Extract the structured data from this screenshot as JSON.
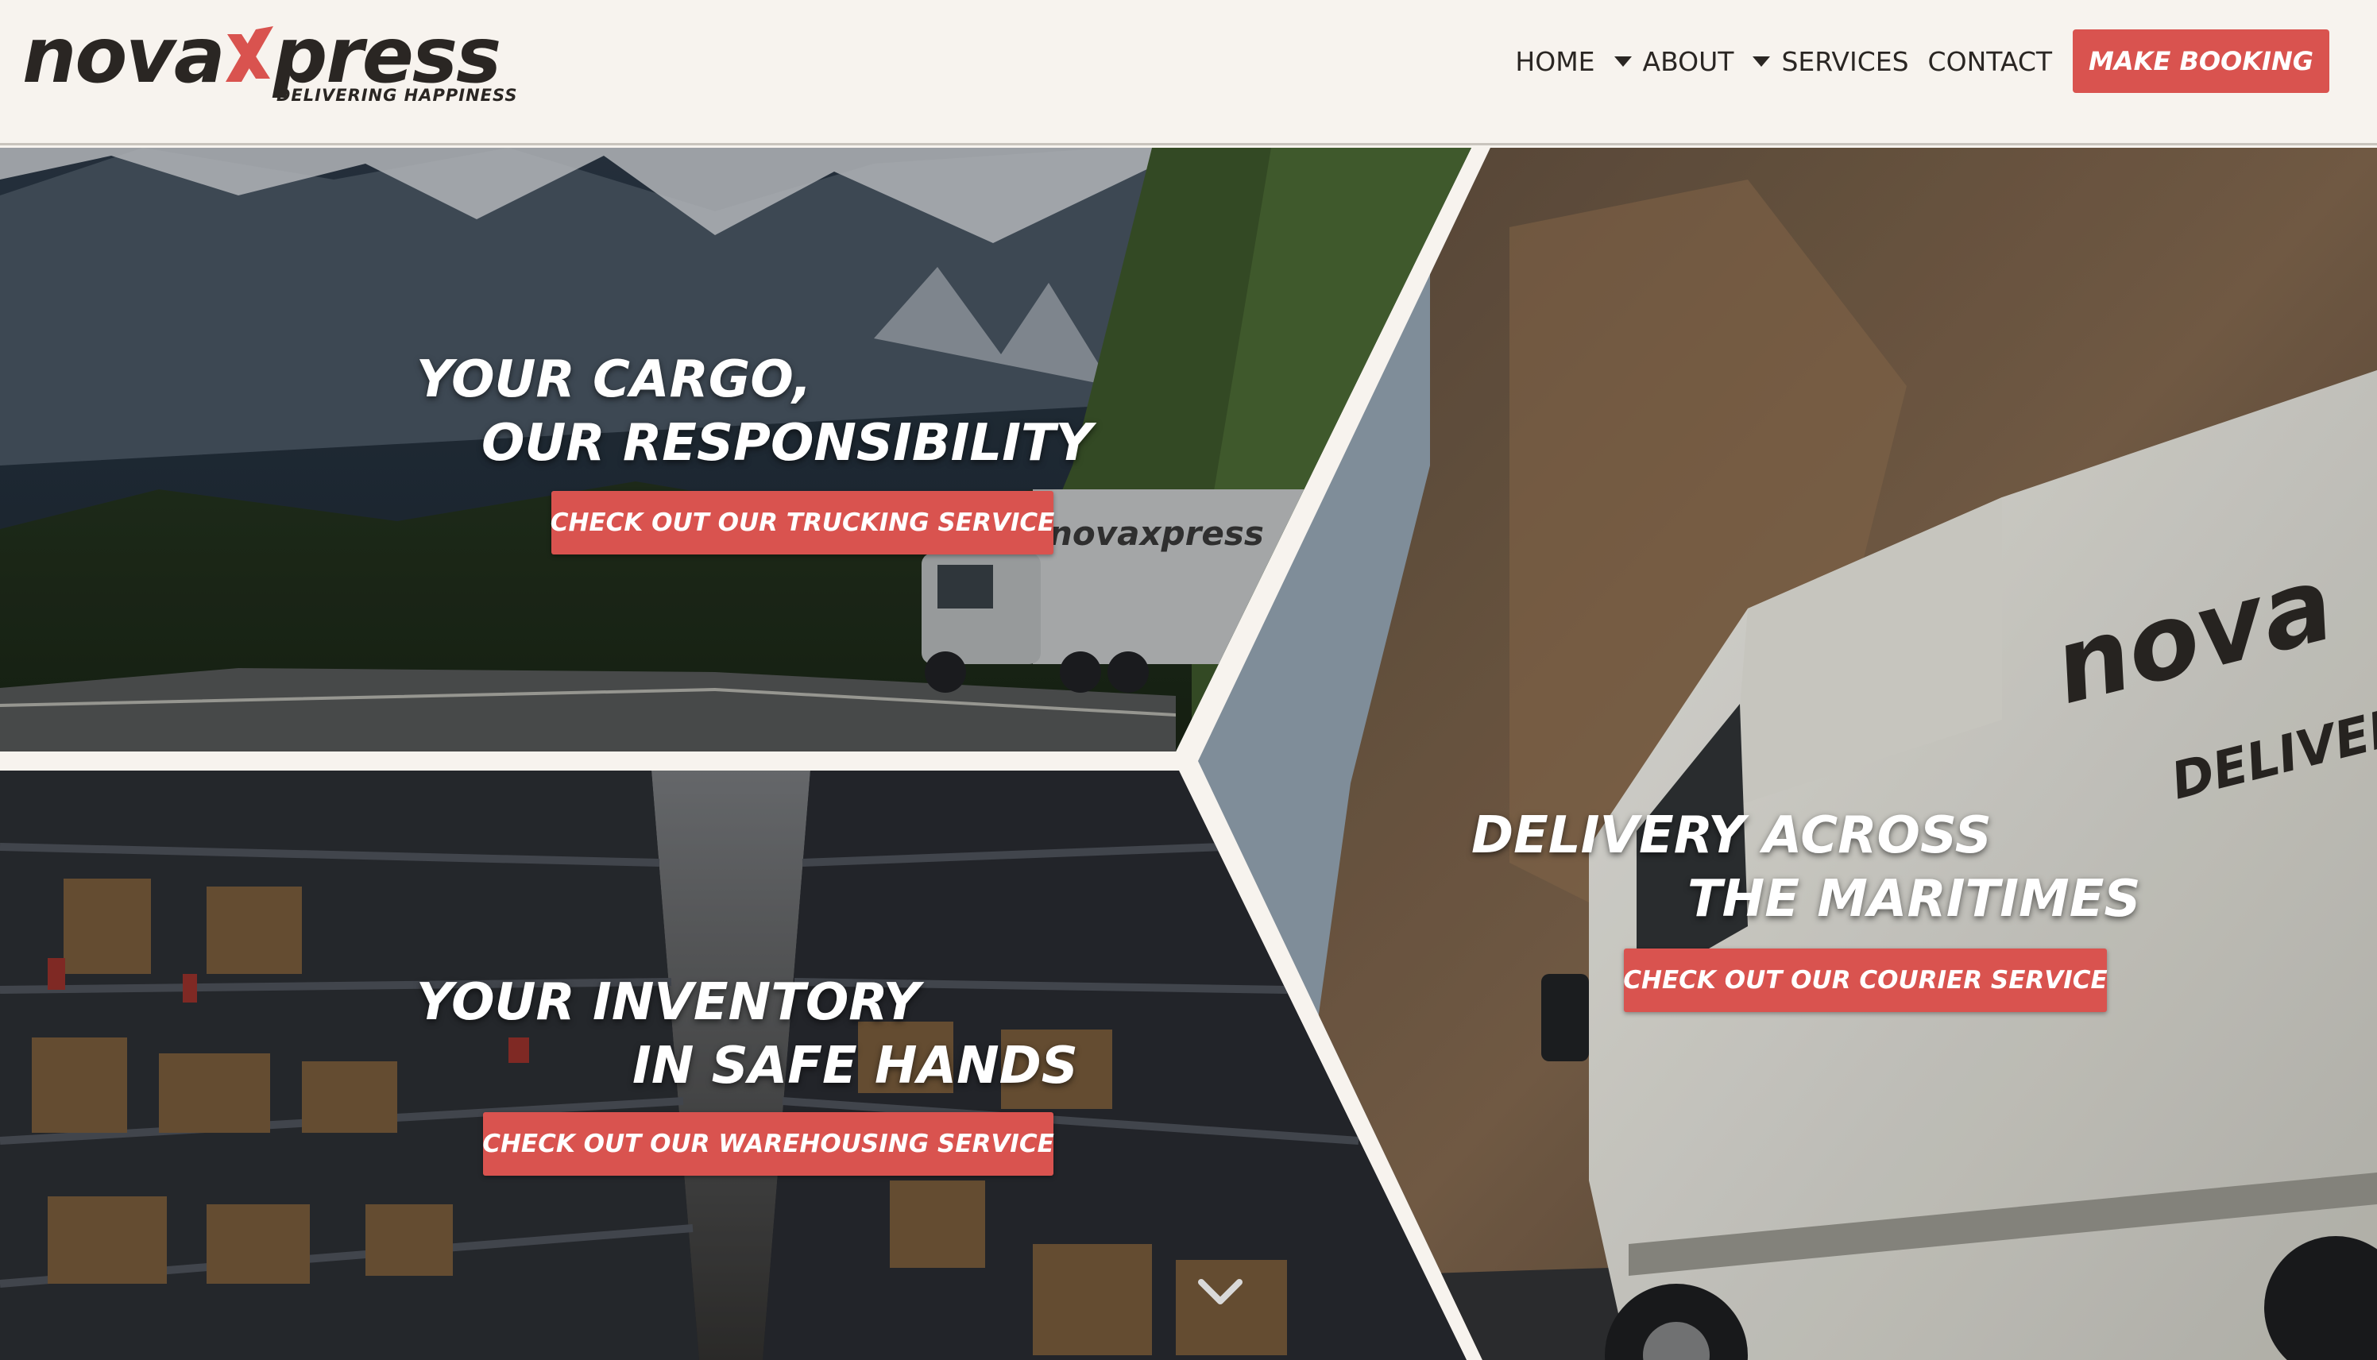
{
  "brand": {
    "name_left": "nova",
    "name_right": "press",
    "tagline": "DELIVERING HAPPINESS",
    "accent_color": "#d9534f"
  },
  "nav": {
    "home": "HOME",
    "about": "ABOUT",
    "services": "SERVICES",
    "contact": "CONTACT",
    "booking": "MAKE BOOKING"
  },
  "hero": {
    "trucking": {
      "line1": "YOUR CARGO,",
      "line2": "OUR RESPONSIBILITY",
      "cta": "CHECK OUT OUR TRUCKING SERVICE"
    },
    "warehousing": {
      "line1": "YOUR INVENTORY",
      "line2": "IN SAFE HANDS",
      "cta": "CHECK OUT OUR WAREHOUSING SERVICE"
    },
    "courier": {
      "line1": "DELIVERY ACROSS",
      "line2": "THE MARITIMES",
      "cta": "CHECK OUT OUR COURIER SERVICE"
    },
    "scroll_icon": "chevron-down-icon"
  }
}
